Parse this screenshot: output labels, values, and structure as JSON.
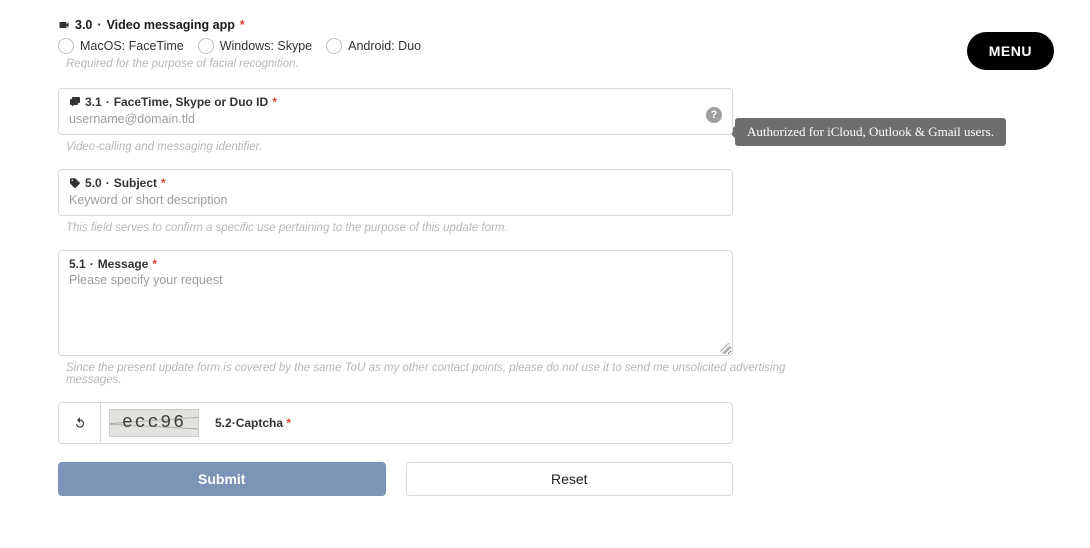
{
  "menu_label": "MENU",
  "q30": {
    "num": "3.0",
    "label": "Video messaging app",
    "options": [
      "MacOS: FaceTime",
      "Windows: Skype",
      "Android: Duo"
    ],
    "helper": "Required for the purpose of facial recognition."
  },
  "q31": {
    "num": "3.1",
    "label": "FaceTime, Skype or Duo ID",
    "placeholder": "username@domain.tld",
    "helper": "Video-calling and messaging identifier.",
    "tooltip": "Authorized for iCloud, Outlook & Gmail users."
  },
  "q50": {
    "num": "5.0",
    "label": "Subject",
    "placeholder": "Keyword or short description",
    "helper": "This field serves to confirm a specific use pertaining to the purpose of this update form."
  },
  "q51": {
    "num": "5.1",
    "label": "Message",
    "placeholder": "Please specify your request",
    "helper": "Since the present update form is covered by the same ToU as my other contact points, please do not use it to send me unsolicited advertising messages."
  },
  "q52": {
    "num": "5.2",
    "label": "Captcha",
    "image_text": "ecc96"
  },
  "buttons": {
    "submit": "Submit",
    "reset": "Reset"
  },
  "sep": " · "
}
